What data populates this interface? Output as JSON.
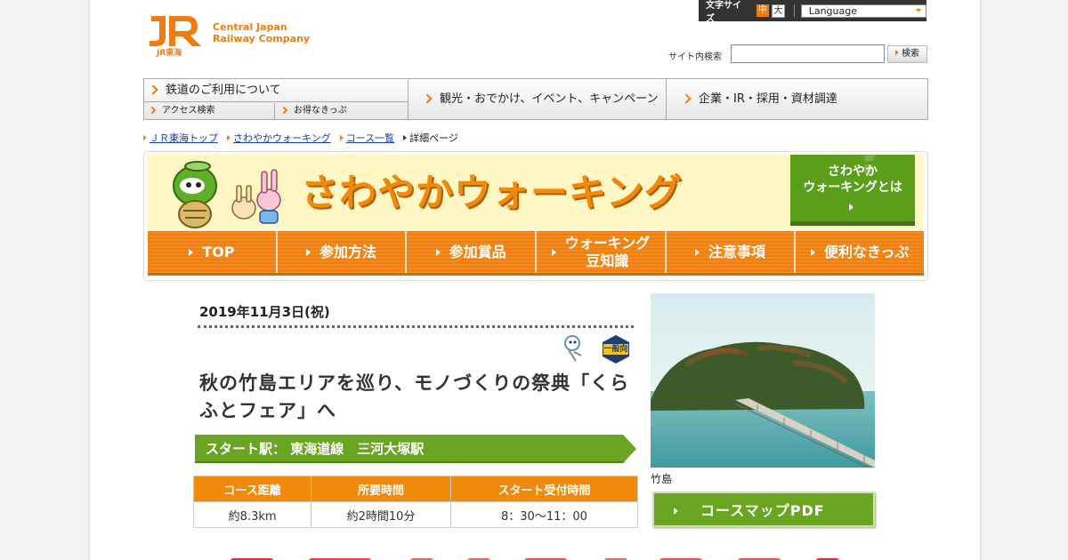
{
  "util": {
    "font_size_label": "文字サイズ",
    "size_mid": "中",
    "size_big": "大",
    "language": "Language"
  },
  "logo": {
    "mark": "JR",
    "sub": "JR東海",
    "company_line1": "Central Japan",
    "company_line2": "Railway Company"
  },
  "search": {
    "label": "サイト内検索",
    "placeholder": "",
    "button": "検索"
  },
  "gnav": {
    "rail": "鉄道のご利用について",
    "access": "アクセス検索",
    "tickets": "お得なきっぷ",
    "tourism": "観光・おでかけ、イベント、キャンペーン",
    "corporate": "企業・IR・採用・資材調達"
  },
  "breadcrumb": [
    {
      "label": "ＪＲ東海トップ"
    },
    {
      "label": "さわやかウォーキング"
    },
    {
      "label": "コース一覧"
    },
    {
      "label": "詳細ページ"
    }
  ],
  "banner": {
    "title": "さわやかウォーキング",
    "what_line1": "さわやか",
    "what_line2": "ウォーキングとは",
    "nav": [
      "TOP",
      "参加方法",
      "参加賞品",
      "ウォーキング",
      "豆知識",
      "注意事項",
      "便利なきっぷ"
    ]
  },
  "event": {
    "date": "2019年11月3日(祝)",
    "badge": "一般向",
    "title": "秋の竹島エリアを巡り、モノづくりの祭典「くらふとフェア」へ",
    "start_station": "スタート駅：  東海道線　三河大塚駅",
    "table_headers": [
      "コース距離",
      "所要時間",
      "スタート受付時間"
    ],
    "table_values": [
      "約8.3km",
      "約2時間10分",
      "8：30～11：00"
    ],
    "photo_caption": "竹島",
    "pdf_button": "コースマップPDF"
  },
  "colors": {
    "accent": "#f07c0f",
    "green": "#6aa521"
  }
}
